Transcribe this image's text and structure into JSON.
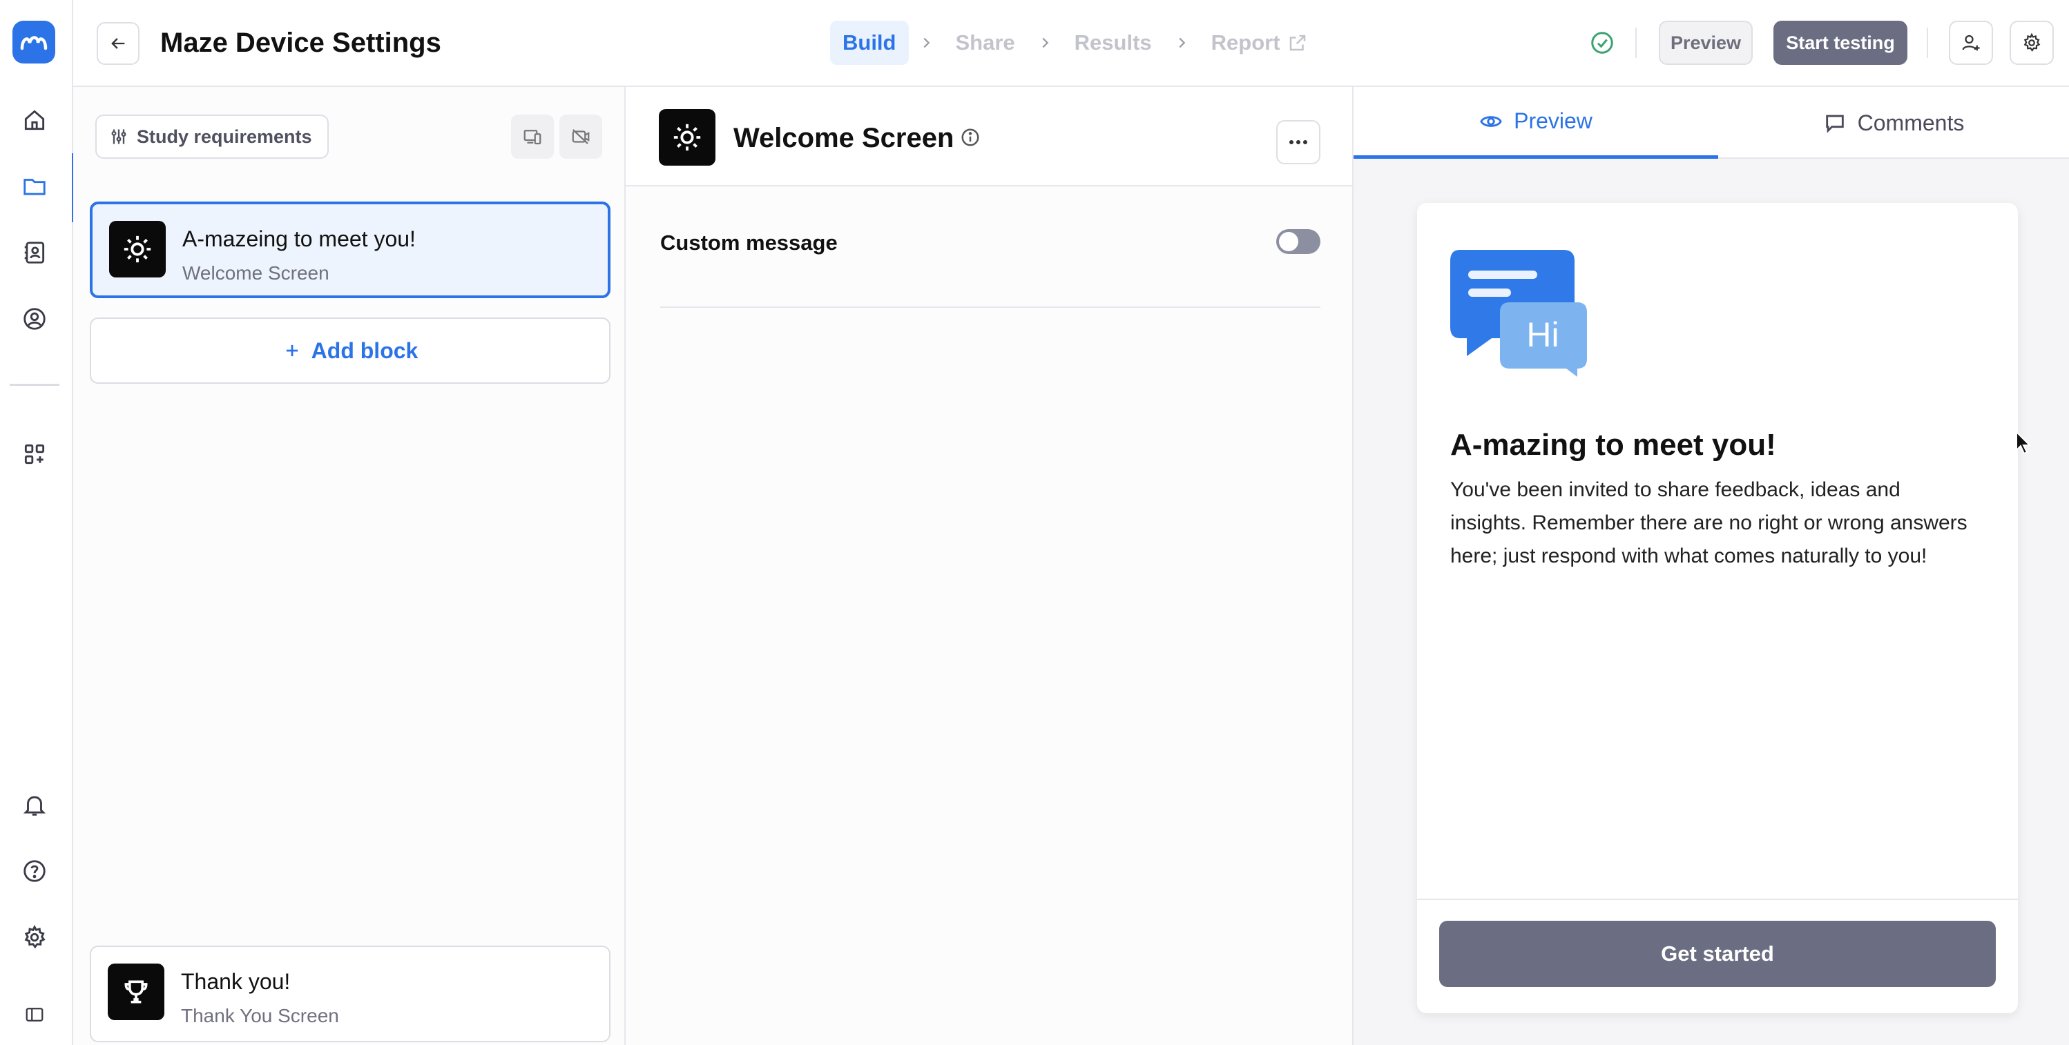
{
  "colors": {
    "accent": "#2b73e6",
    "primary_button": "#6b6d82",
    "success": "#3ca370"
  },
  "header": {
    "title": "Maze Device Settings",
    "steps": [
      {
        "label": "Build",
        "active": true
      },
      {
        "label": "Share",
        "active": false
      },
      {
        "label": "Results",
        "active": false
      },
      {
        "label": "Report",
        "active": false
      }
    ],
    "preview_label": "Preview",
    "start_testing_label": "Start testing"
  },
  "left_panel": {
    "study_requirements_label": "Study requirements",
    "blocks": [
      {
        "title": "A-mazeing to meet you!",
        "subtitle": "Welcome Screen",
        "icon": "sun-icon"
      },
      {
        "title": "Thank you!",
        "subtitle": "Thank You Screen",
        "icon": "trophy-icon"
      }
    ],
    "add_block_label": "Add block"
  },
  "editor": {
    "title": "Welcome Screen",
    "custom_message_label": "Custom message"
  },
  "right_panel": {
    "tabs": [
      {
        "label": "Preview",
        "icon": "eye-icon"
      },
      {
        "label": "Comments",
        "icon": "comment-icon"
      }
    ],
    "preview": {
      "bubble_text": "Hi",
      "title": "A-mazing to meet you!",
      "body": "You've been invited to share feedback, ideas and insights. Remember there are no right or wrong answers here; just respond with what comes naturally to you!",
      "cta_label": "Get started"
    }
  }
}
